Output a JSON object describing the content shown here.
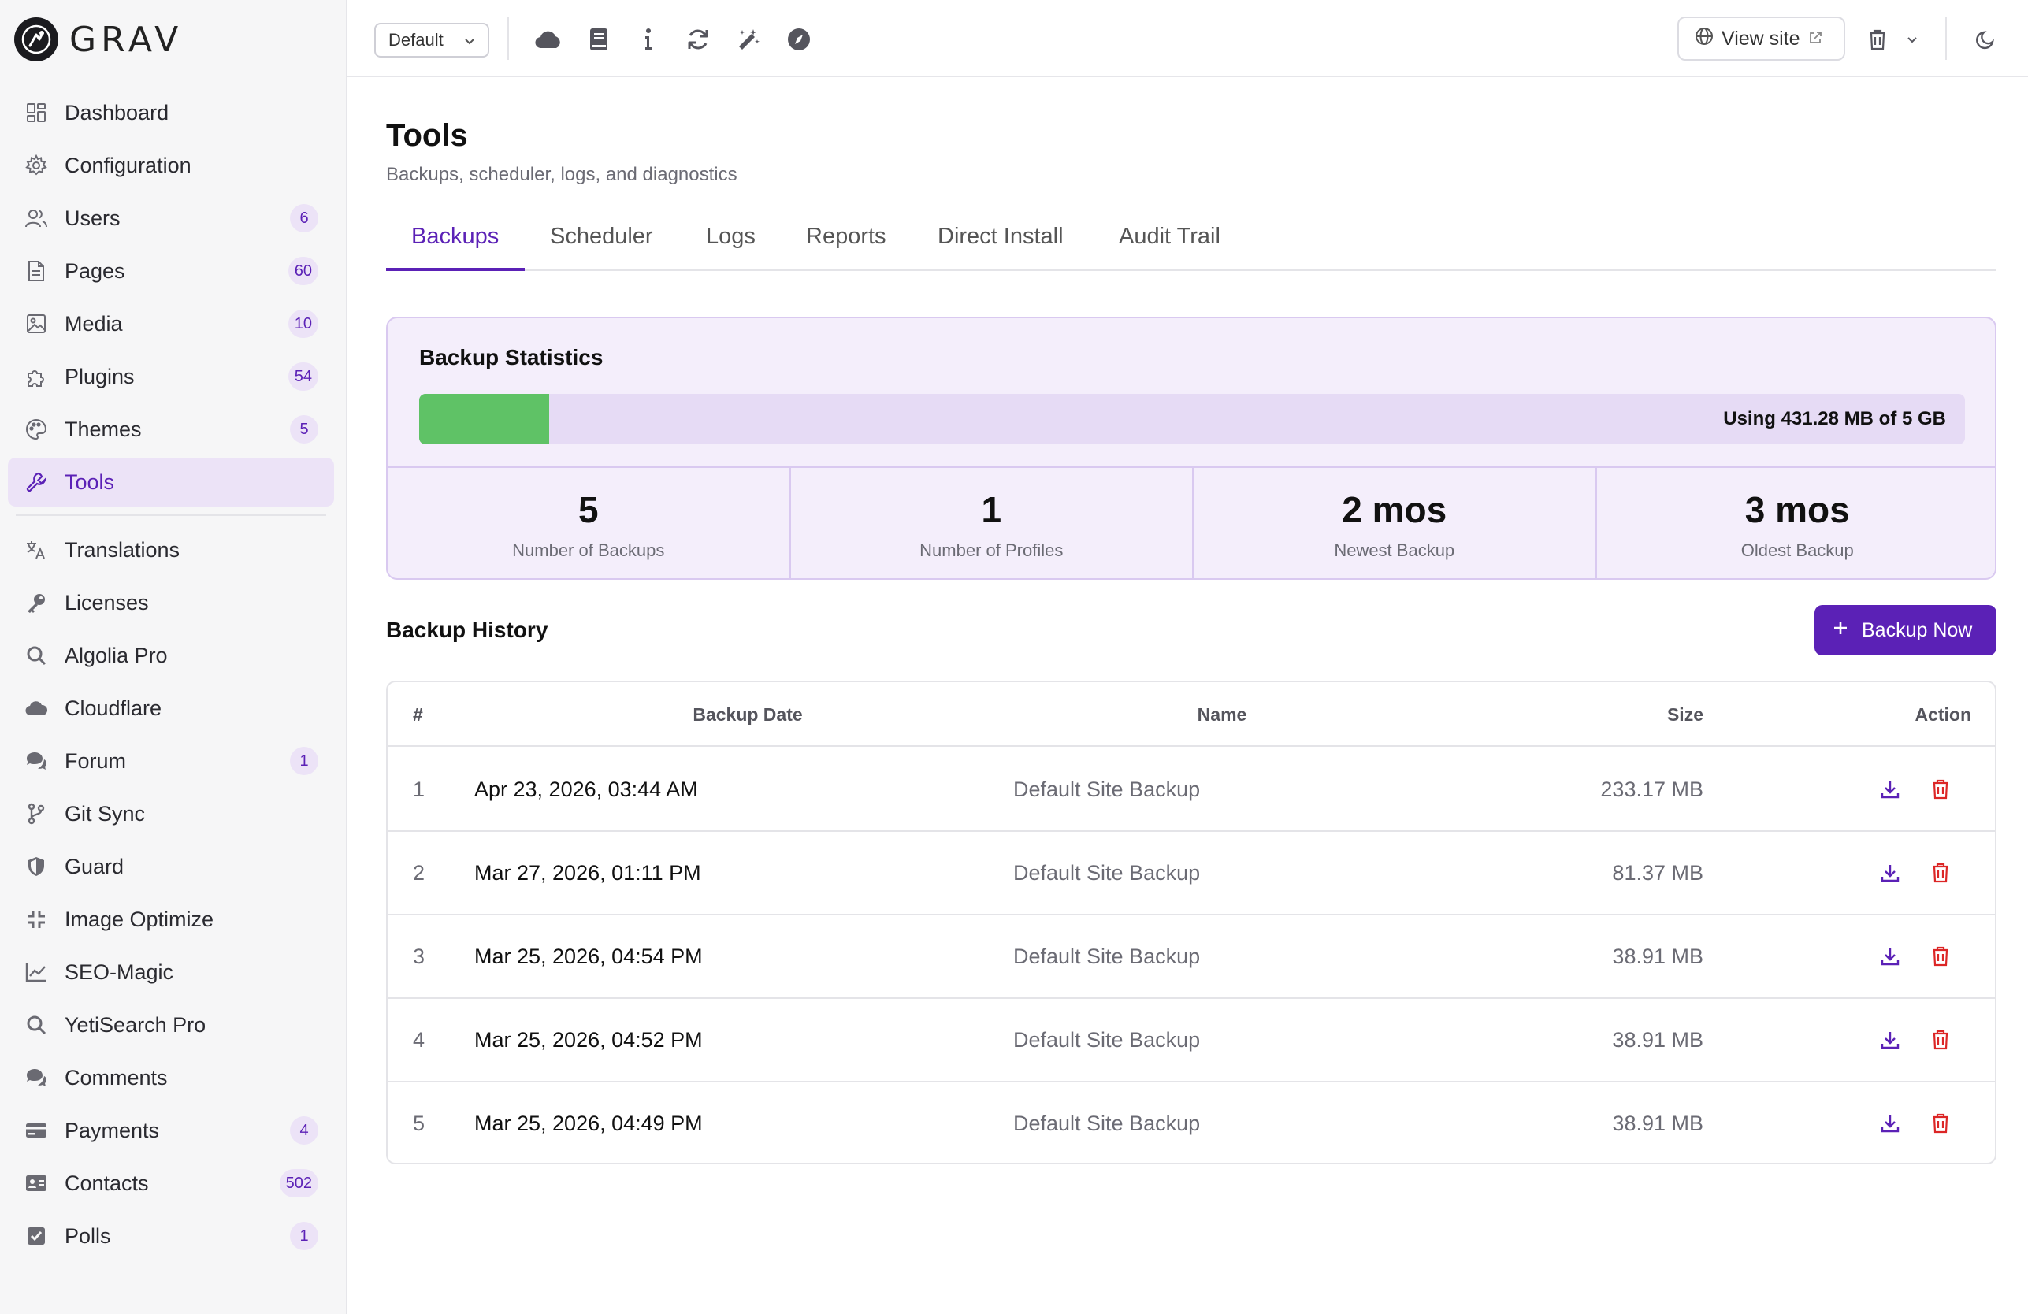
{
  "brand": {
    "name": "GRAV"
  },
  "sidebar": {
    "primary": [
      {
        "label": "Dashboard",
        "icon": "dashboard-icon"
      },
      {
        "label": "Configuration",
        "icon": "gear-icon"
      },
      {
        "label": "Users",
        "icon": "users-icon",
        "badge": "6"
      },
      {
        "label": "Pages",
        "icon": "page-icon",
        "badge": "60"
      },
      {
        "label": "Media",
        "icon": "image-icon",
        "badge": "10"
      },
      {
        "label": "Plugins",
        "icon": "puzzle-icon",
        "badge": "54"
      },
      {
        "label": "Themes",
        "icon": "palette-icon",
        "badge": "5"
      },
      {
        "label": "Tools",
        "icon": "wrench-icon",
        "active": true
      }
    ],
    "secondary": [
      {
        "label": "Translations",
        "icon": "translate-icon"
      },
      {
        "label": "Licenses",
        "icon": "key-icon"
      },
      {
        "label": "Algolia Pro",
        "icon": "search-icon"
      },
      {
        "label": "Cloudflare",
        "icon": "cloud-icon"
      },
      {
        "label": "Forum",
        "icon": "chat-icon",
        "badge": "1"
      },
      {
        "label": "Git Sync",
        "icon": "git-branch-icon"
      },
      {
        "label": "Guard",
        "icon": "shield-icon"
      },
      {
        "label": "Image Optimize",
        "icon": "compress-icon"
      },
      {
        "label": "SEO-Magic",
        "icon": "line-chart-icon"
      },
      {
        "label": "YetiSearch Pro",
        "icon": "search-icon"
      },
      {
        "label": "Comments",
        "icon": "comments-icon"
      },
      {
        "label": "Payments",
        "icon": "credit-card-icon",
        "badge": "4"
      },
      {
        "label": "Contacts",
        "icon": "contact-card-icon",
        "badge": "502"
      },
      {
        "label": "Polls",
        "icon": "checkbox-icon",
        "badge": "1"
      }
    ]
  },
  "topbar": {
    "environment": "Default",
    "view_site": "View site"
  },
  "page": {
    "title": "Tools",
    "subtitle": "Backups, scheduler, logs, and diagnostics",
    "tabs": [
      "Backups",
      "Scheduler",
      "Logs",
      "Reports",
      "Direct Install",
      "Audit Trail"
    ],
    "active_tab": "Backups"
  },
  "stats": {
    "title": "Backup Statistics",
    "usage_label": "Using 431.28 MB of 5 GB",
    "usage_fraction": 0.0842,
    "items": [
      {
        "value": "5",
        "caption": "Number of Backups"
      },
      {
        "value": "1",
        "caption": "Number of Profiles"
      },
      {
        "value": "2 mos",
        "caption": "Newest Backup"
      },
      {
        "value": "3 mos",
        "caption": "Oldest Backup"
      }
    ]
  },
  "history": {
    "title": "Backup History",
    "backup_button": "Backup Now",
    "columns": {
      "num": "#",
      "date": "Backup Date",
      "name": "Name",
      "size": "Size",
      "action": "Action"
    },
    "rows": [
      {
        "num": "1",
        "date": "Apr 23, 2026, 03:44 AM",
        "name": "Default Site Backup",
        "size": "233.17 MB"
      },
      {
        "num": "2",
        "date": "Mar 27, 2026, 01:11 PM",
        "name": "Default Site Backup",
        "size": "81.37 MB"
      },
      {
        "num": "3",
        "date": "Mar 25, 2026, 04:54 PM",
        "name": "Default Site Backup",
        "size": "38.91 MB"
      },
      {
        "num": "4",
        "date": "Mar 25, 2026, 04:52 PM",
        "name": "Default Site Backup",
        "size": "38.91 MB"
      },
      {
        "num": "5",
        "date": "Mar 25, 2026, 04:49 PM",
        "name": "Default Site Backup",
        "size": "38.91 MB"
      }
    ]
  },
  "colors": {
    "accent": "#5b21b6",
    "usage_bar": "#5fc266",
    "delete": "#dc2626"
  }
}
